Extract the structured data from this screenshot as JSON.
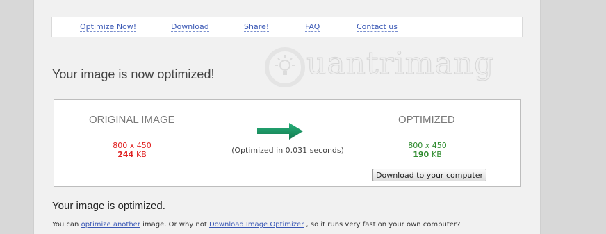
{
  "nav": {
    "items": [
      "Optimize Now!",
      "Download",
      "Share!",
      "FAQ",
      "Contact us"
    ]
  },
  "watermark": {
    "text": "uantrimang"
  },
  "page_title": "Your image is now optimized!",
  "result": {
    "original": {
      "heading": "ORIGINAL IMAGE",
      "dimensions": "800 x 450",
      "size_value": "244",
      "size_unit": "KB",
      "color": "#e02020"
    },
    "timing": "(Optimized in 0.031 seconds)",
    "optimized": {
      "heading": "OPTIMIZED",
      "dimensions": "800 x 450",
      "size_value": "190",
      "size_unit": "KB",
      "color": "#2e8b2e"
    },
    "download_button": "Download to your computer",
    "arrow_color": "#1e9a6a"
  },
  "subheading": "Your image is optimized.",
  "footer": {
    "prefix": "You can",
    "link1": "optimize another",
    "middle": "image. Or why not",
    "link2": "Download Image Optimizer",
    "suffix": ", so it runs very fast on your own computer?"
  }
}
